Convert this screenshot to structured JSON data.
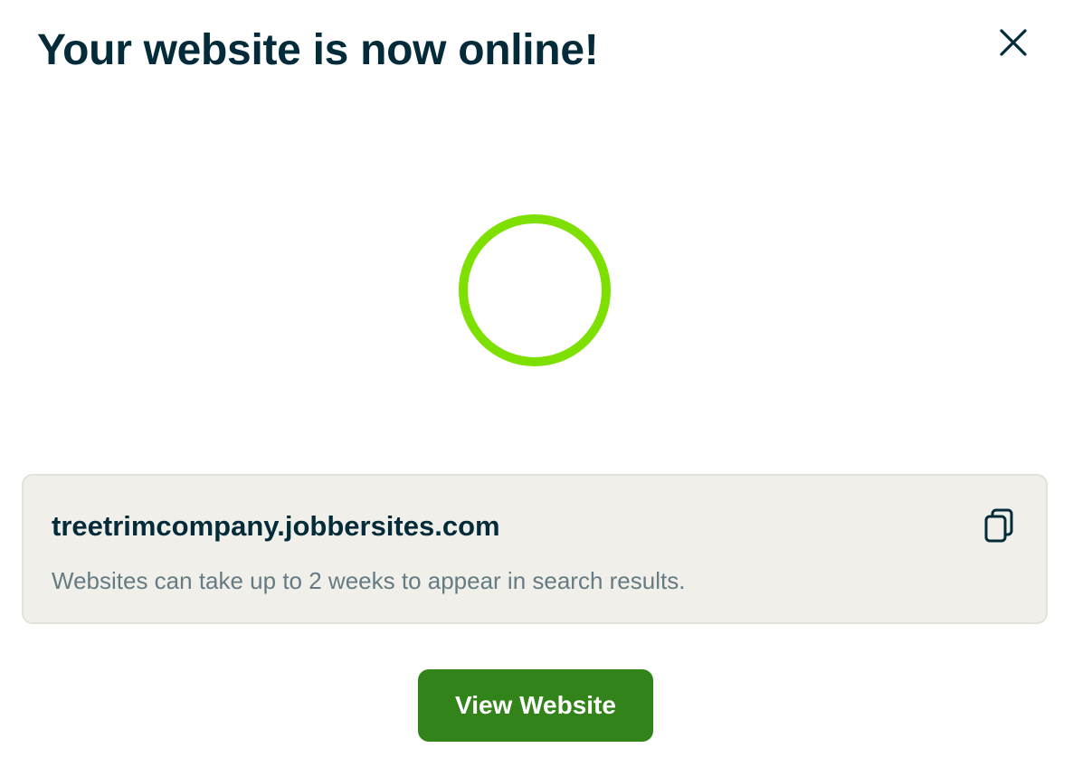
{
  "dialog": {
    "title": "Your website is now online!",
    "close_icon": "close-icon",
    "spinner": {
      "icon": "loading-spinner-icon",
      "color": "#7ee000"
    },
    "url_card": {
      "url": "treetrimcompany.jobbersites.com",
      "note": "Websites can take up to 2 weeks to appear in search results.",
      "copy_icon": "copy-icon"
    },
    "primary_button": {
      "label": "View Website",
      "color": "#33831b"
    }
  },
  "colors": {
    "heading": "#032b3a",
    "muted_text": "#657b84",
    "card_background": "#f1efe9"
  }
}
